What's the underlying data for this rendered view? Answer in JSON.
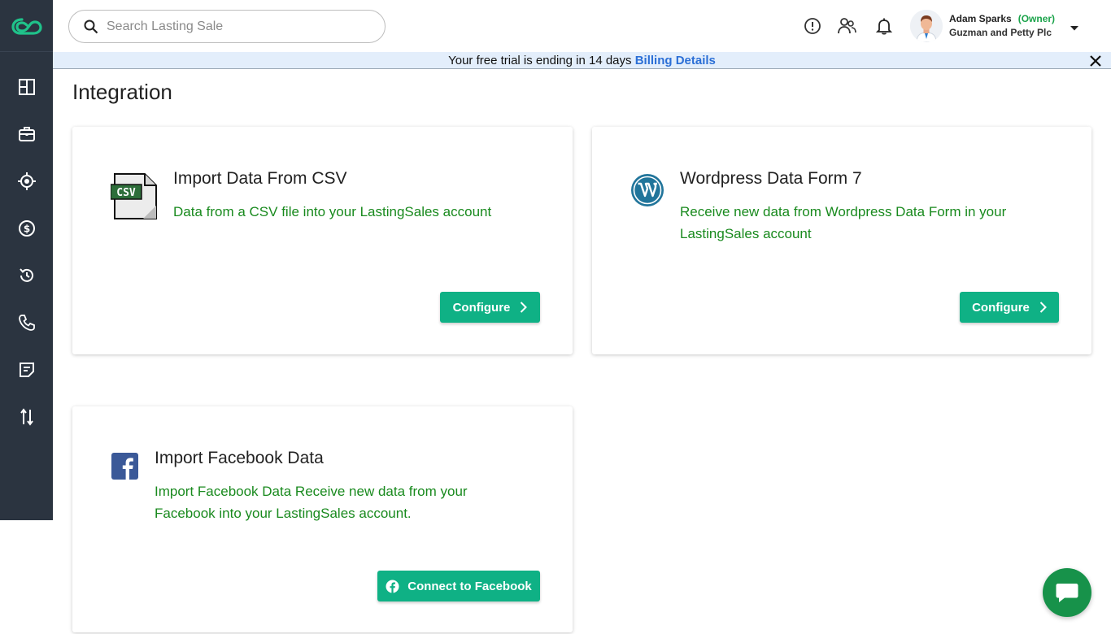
{
  "app": {
    "logo_icon": "lastingsales-logo-icon"
  },
  "sidebar": {
    "items": [
      {
        "icon": "dashboard-icon"
      },
      {
        "icon": "briefcase-icon"
      },
      {
        "icon": "target-icon"
      },
      {
        "icon": "dollar-icon"
      },
      {
        "icon": "history-icon"
      },
      {
        "icon": "phone-icon"
      },
      {
        "icon": "notes-icon"
      },
      {
        "icon": "transfer-icon"
      }
    ]
  },
  "header": {
    "search_placeholder": "Search Lasting Sale",
    "user": {
      "name": "Adam Sparks",
      "role": "(Owner)",
      "company": "Guzman and Petty Plc"
    }
  },
  "banner": {
    "text": "Your free trial is ending in 14 days",
    "link": "Billing Details"
  },
  "page": {
    "title": "Integration"
  },
  "cards": [
    {
      "title": "Import Data From CSV",
      "description": "Data from a CSV file into your LastingSales account",
      "button": "Configure",
      "icon": "csv-file-icon",
      "icon_text": "CSV"
    },
    {
      "title": "Wordpress Data Form 7",
      "description": "Receive new data from Wordpress Data Form in your LastingSales account",
      "button": "Configure",
      "icon": "wordpress-icon"
    },
    {
      "title": "Import Facebook Data",
      "description": "Import Facebook Data Receive new data from your Facebook into your LastingSales account.",
      "button": "Connect to Facebook",
      "icon": "facebook-icon"
    }
  ],
  "colors": {
    "sidebar": "#2b3440",
    "accent": "#0fb185",
    "desc_green": "#198a1e",
    "link_blue": "#2b6fd6",
    "banner_bg": "#e3eefb",
    "chat": "#17924a"
  }
}
